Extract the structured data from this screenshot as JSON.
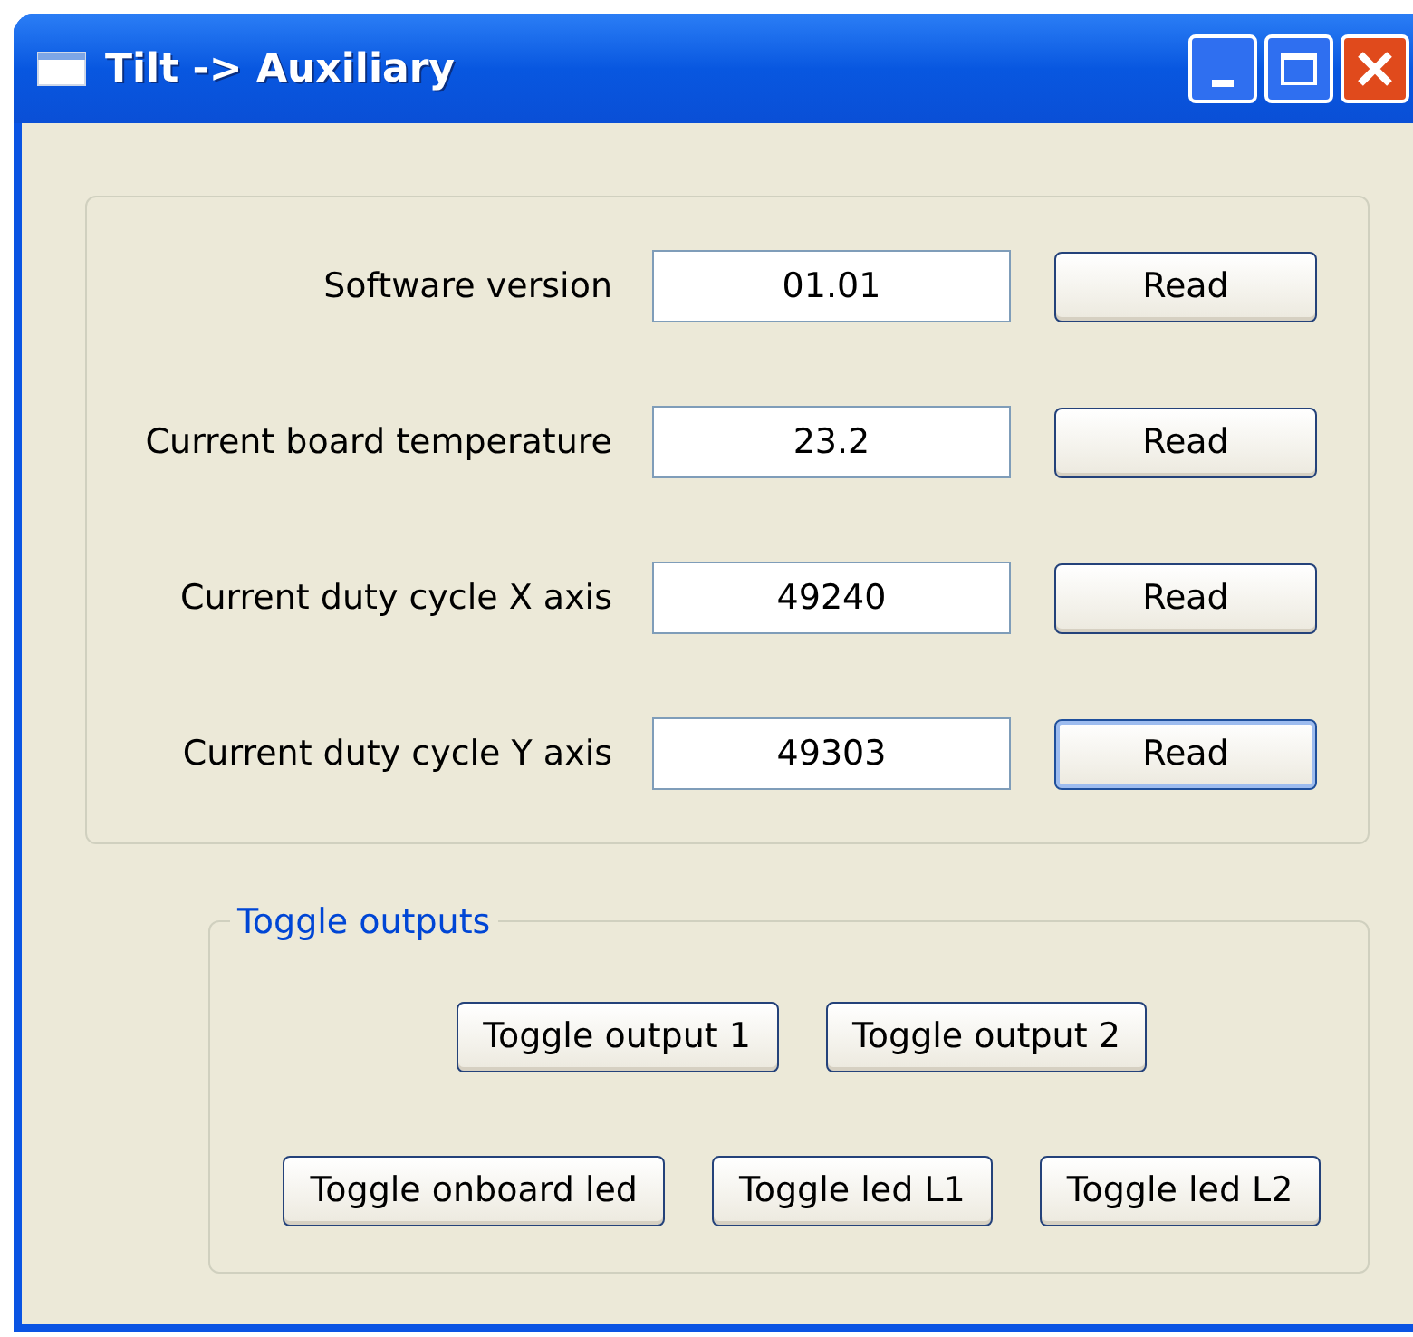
{
  "window": {
    "title": "Tilt -> Auxiliary"
  },
  "readings": [
    {
      "label": "Software version",
      "value": "01.01",
      "button": {
        "label": "Read",
        "focused": false
      }
    },
    {
      "label": "Current board temperature",
      "value": "23.2",
      "button": {
        "label": "Read",
        "focused": false
      }
    },
    {
      "label": "Current duty cycle X axis",
      "value": "49240",
      "button": {
        "label": "Read",
        "focused": false
      }
    },
    {
      "label": "Current duty cycle Y axis",
      "value": "49303",
      "button": {
        "label": "Read",
        "focused": true
      }
    }
  ],
  "toggle_group": {
    "title": "Toggle outputs",
    "rows": [
      [
        {
          "label": "Toggle output 1"
        },
        {
          "label": "Toggle output 2"
        }
      ],
      [
        {
          "label": "Toggle onboard led"
        },
        {
          "label": "Toggle led L1"
        },
        {
          "label": "Toggle led L2"
        }
      ]
    ]
  }
}
